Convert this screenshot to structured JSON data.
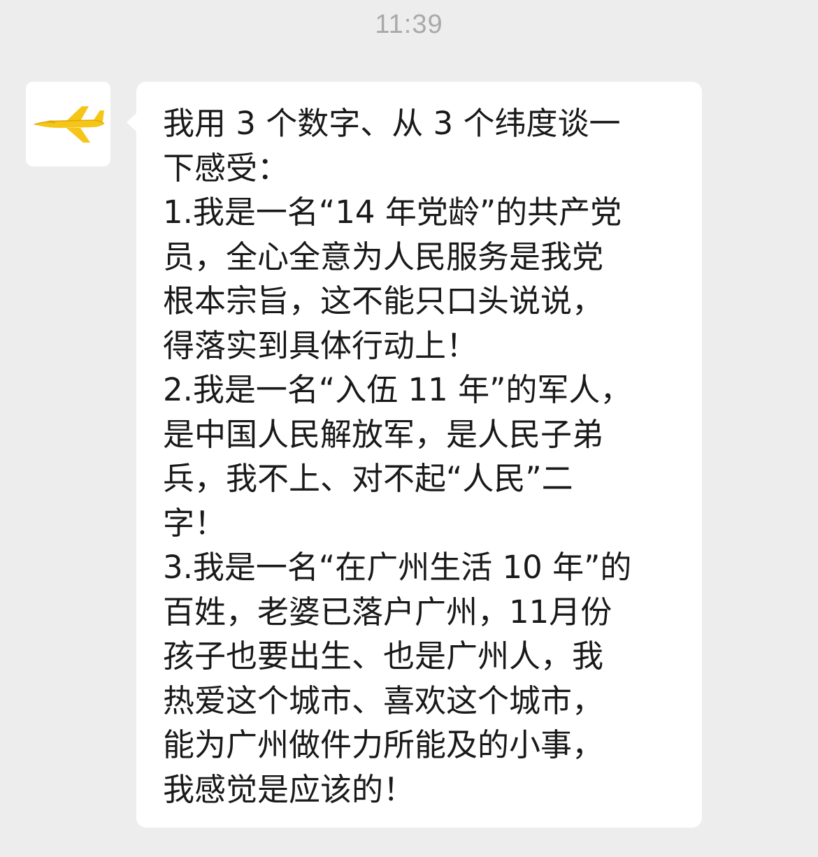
{
  "chat": {
    "timestamp": "11:39",
    "sender": {
      "avatar_icon": "airplane-icon",
      "avatar_color": "#f5c518"
    },
    "message": {
      "text": "我用 3 个数字、从 3 个纬度谈一\n下感受：\n1.我是一名“14 年党龄”的共产党\n员，全心全意为人民服务是我党\n根本宗旨，这不能只口头说说，\n得落实到具体行动上！\n2.我是一名“入伍 11 年”的军人，\n是中国人民解放军，是人民子弟\n兵，我不上、对不起“人民”二\n字！\n3.我是一名“在广州生活 10 年”的\n百姓，老婆已落户广州，11月份\n孩子也要出生、也是广州人，我\n热爱这个城市、喜欢这个城市，\n能为广州做件力所能及的小事，\n我感觉是应该的！"
    }
  }
}
